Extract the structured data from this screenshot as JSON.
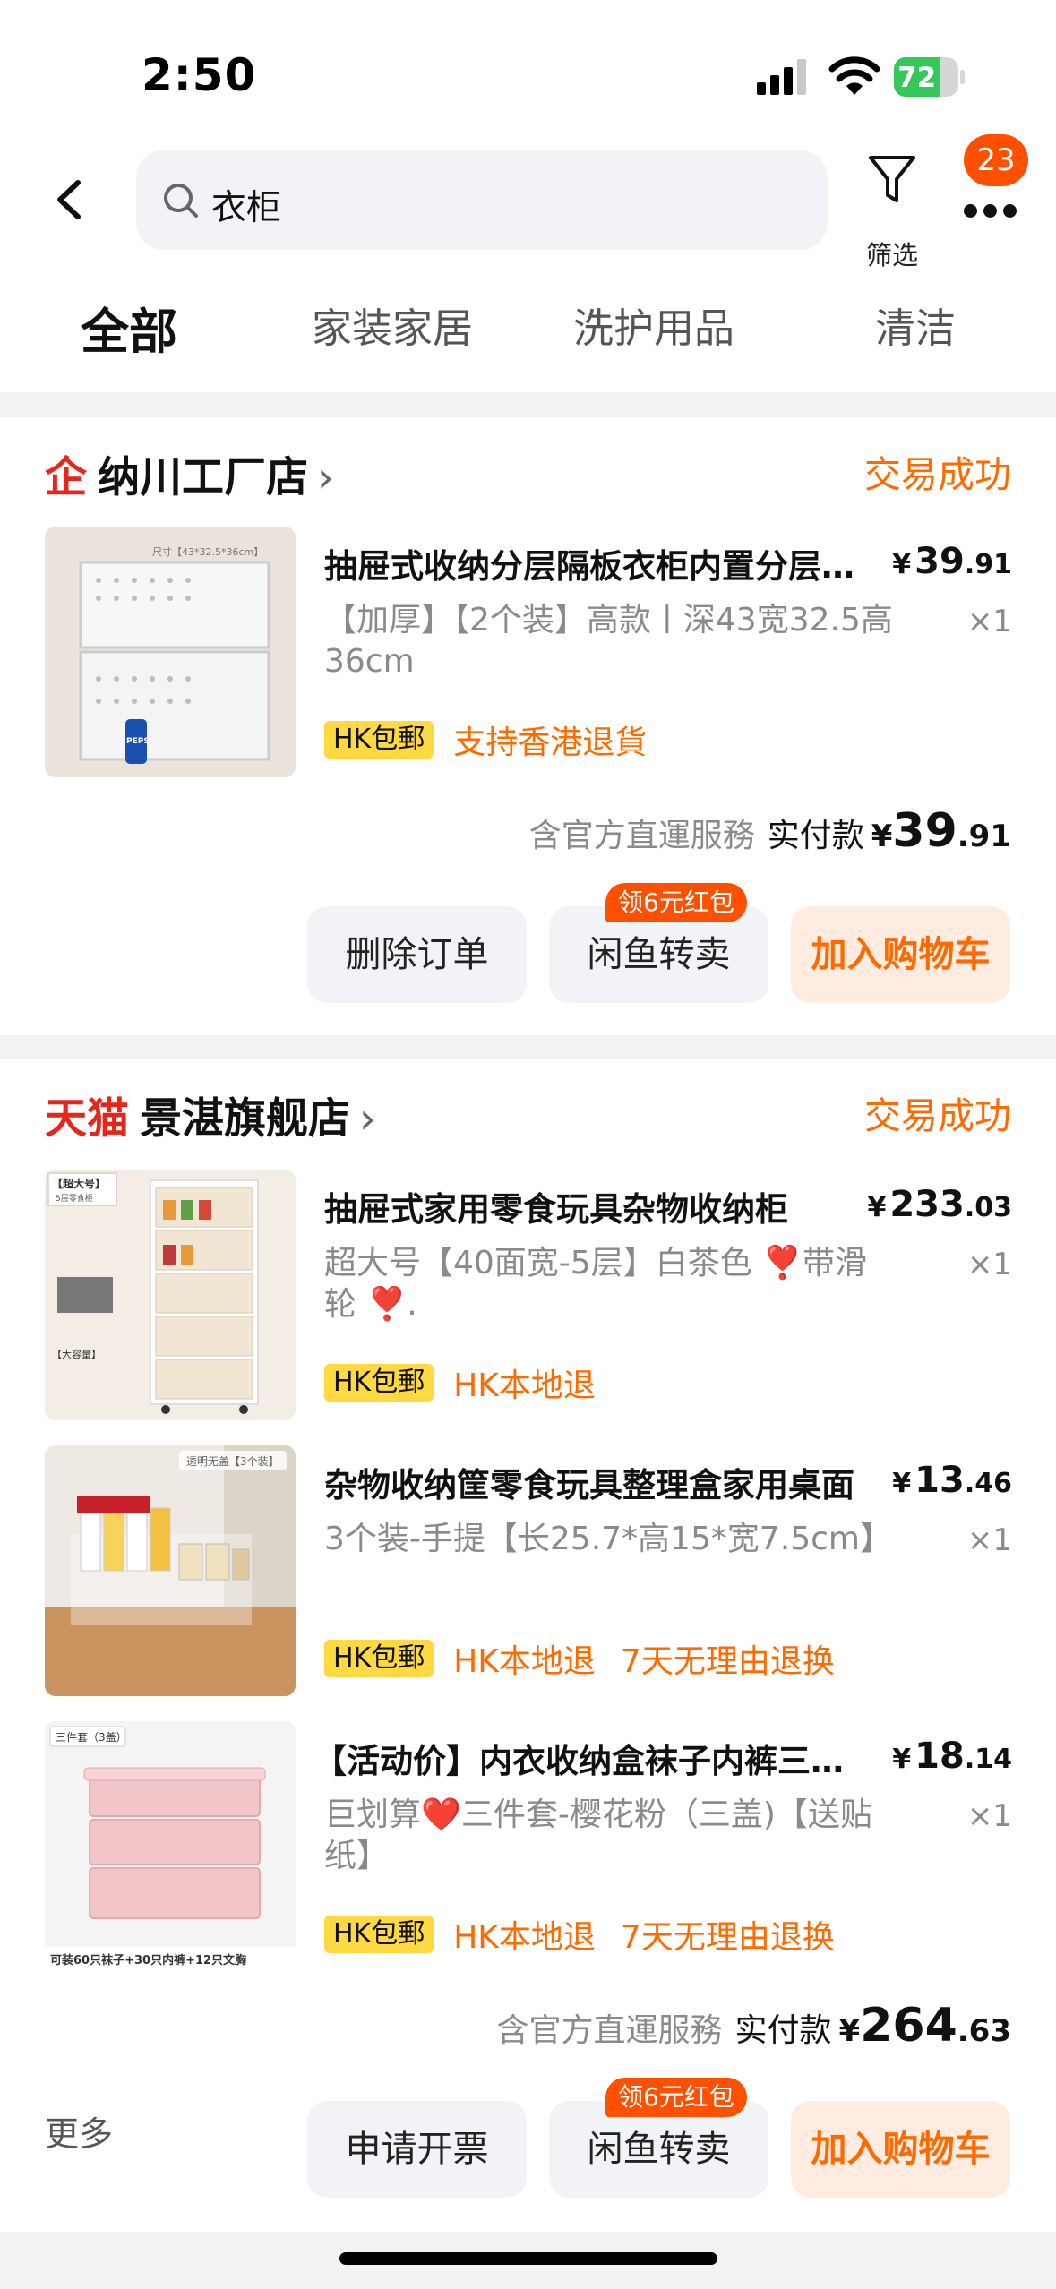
{
  "status": {
    "time": "2:50",
    "battery": "72",
    "battery_level": 0.72
  },
  "header": {
    "search_text": "衣柜",
    "filter_label": "筛选",
    "notif_count": "23"
  },
  "tabs": [
    "全部",
    "家装家居",
    "洗护用品",
    "清洁"
  ],
  "orders": [
    {
      "shop_logo": "企",
      "shop_name": "纳川工厂店",
      "status": "交易成功",
      "items": [
        {
          "title": "抽屉式收纳分层隔板衣柜内置分层收纳",
          "sku": "【加厚】【2个装】高款丨深43宽32.5高36cm",
          "price_int": "39",
          "price_dec": ".91",
          "qty": "×1",
          "tag_yellow": "HK包郵",
          "tags": [
            "支持香港退貨"
          ]
        }
      ],
      "service": "含官方直運服務",
      "paid_label": "实付款",
      "paid_int": "39",
      "paid_dec": ".91",
      "bubble": "领6元红包",
      "buttons": [
        "删除订单",
        "闲鱼转卖",
        "加入购物车"
      ]
    },
    {
      "shop_logo": "天猫",
      "shop_name": "景湛旗舰店",
      "status": "交易成功",
      "items": [
        {
          "title": "抽屉式家用零食玩具杂物收纳柜",
          "sku": "超大号【40面宽-5层】白茶色 ❣️带滑轮 ❣️.",
          "price_int": "233",
          "price_dec": ".03",
          "qty": "×1",
          "tag_yellow": "HK包郵",
          "tags": [
            "HK本地退"
          ]
        },
        {
          "title": "杂物收纳筐零食玩具整理盒家用桌面",
          "sku": "3个装-手提【长25.7*高15*宽7.5cm】",
          "price_int": "13",
          "price_dec": ".46",
          "qty": "×1",
          "tag_yellow": "HK包郵",
          "tags": [
            "HK本地退",
            "7天无理由退换"
          ]
        },
        {
          "title": "【活动价】内衣收纳盒袜子内裤三合一",
          "sku": "巨划算❤️三件套-樱花粉（三盖)【送贴纸】",
          "price_int": "18",
          "price_dec": ".14",
          "qty": "×1",
          "tag_yellow": "HK包郵",
          "tags": [
            "HK本地退",
            "7天无理由退换"
          ]
        }
      ],
      "service": "含官方直運服務",
      "paid_label": "实付款",
      "paid_int": "264",
      "paid_dec": ".63",
      "bubble": "领6元红包",
      "more": "更多",
      "buttons": [
        "申请开票",
        "闲鱼转卖",
        "加入购物车"
      ]
    }
  ],
  "images": {
    "img1_size": "尺寸【43*32.5*36cm】",
    "img1_brand": "PEPSI",
    "img2_label1": "【超大号】",
    "img2_label2": "5层零食柜",
    "img2_label3": "【大容量】",
    "img3_label": "透明无盖【3个装】",
    "img4_label": "三件套（3盖）",
    "img4_bottom": "可装60只袜子+30只内裤+12只文胸"
  },
  "currency": "¥",
  "colors": {
    "accent": "#ff6a00",
    "badge": "#ff5000",
    "tag_yellow": "#ffd941",
    "tmall_red": "#e6251c"
  }
}
